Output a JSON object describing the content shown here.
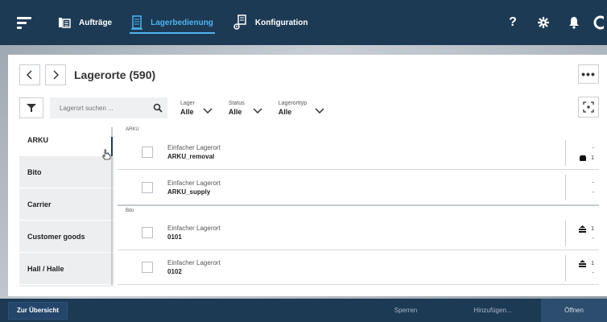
{
  "topbar": {
    "nav": [
      {
        "label": "Aufträge",
        "icon": "document-icon"
      },
      {
        "label": "Lagerbedienung",
        "icon": "shelf-icon",
        "active": true
      },
      {
        "label": "Konfiguration",
        "icon": "config-icon"
      }
    ],
    "help_label": "?",
    "colors": {
      "bar": "#1d3a55",
      "accent": "#4db4f0"
    }
  },
  "header": {
    "title": "Lagerorte (590)",
    "more_label": "•••"
  },
  "filters": {
    "search_placeholder": "Lagerort suchen ...",
    "dropdowns": [
      {
        "label": "Lager",
        "value": "Alle"
      },
      {
        "label": "Status",
        "value": "Alle"
      },
      {
        "label": "Lagerorttyp",
        "value": "Alle"
      }
    ]
  },
  "sidebar": {
    "items": [
      {
        "label": "ARKU",
        "active": true
      },
      {
        "label": "Bito"
      },
      {
        "label": "Carrier"
      },
      {
        "label": "Customer goods"
      },
      {
        "label": "Hall / Halle"
      }
    ]
  },
  "list": {
    "groups": [
      {
        "name": "ARKU",
        "rows": [
          {
            "type": "Einfacher Lagerort",
            "name": "ARKU_removal",
            "top": "-",
            "bottom": "1",
            "top_icon": "",
            "bottom_icon": "box-icon"
          },
          {
            "type": "Einfacher Lagerort",
            "name": "ARKU_supply",
            "top": "-",
            "bottom": "-",
            "top_icon": "",
            "bottom_icon": ""
          }
        ]
      },
      {
        "name": "Bito",
        "rows": [
          {
            "type": "Einfacher Lagerort",
            "name": "0101",
            "top": "1",
            "bottom": "-",
            "top_icon": "stack-icon",
            "bottom_icon": ""
          },
          {
            "type": "Einfacher Lagerort",
            "name": "0102",
            "top": "1",
            "bottom": "-",
            "top_icon": "stack-icon",
            "bottom_icon": ""
          }
        ]
      }
    ]
  },
  "bottombar": {
    "overview_label": "Zur Übersicht",
    "lock_label": "Sperren",
    "add_label": "Hinzufügen...",
    "open_label": "Öffnen"
  }
}
